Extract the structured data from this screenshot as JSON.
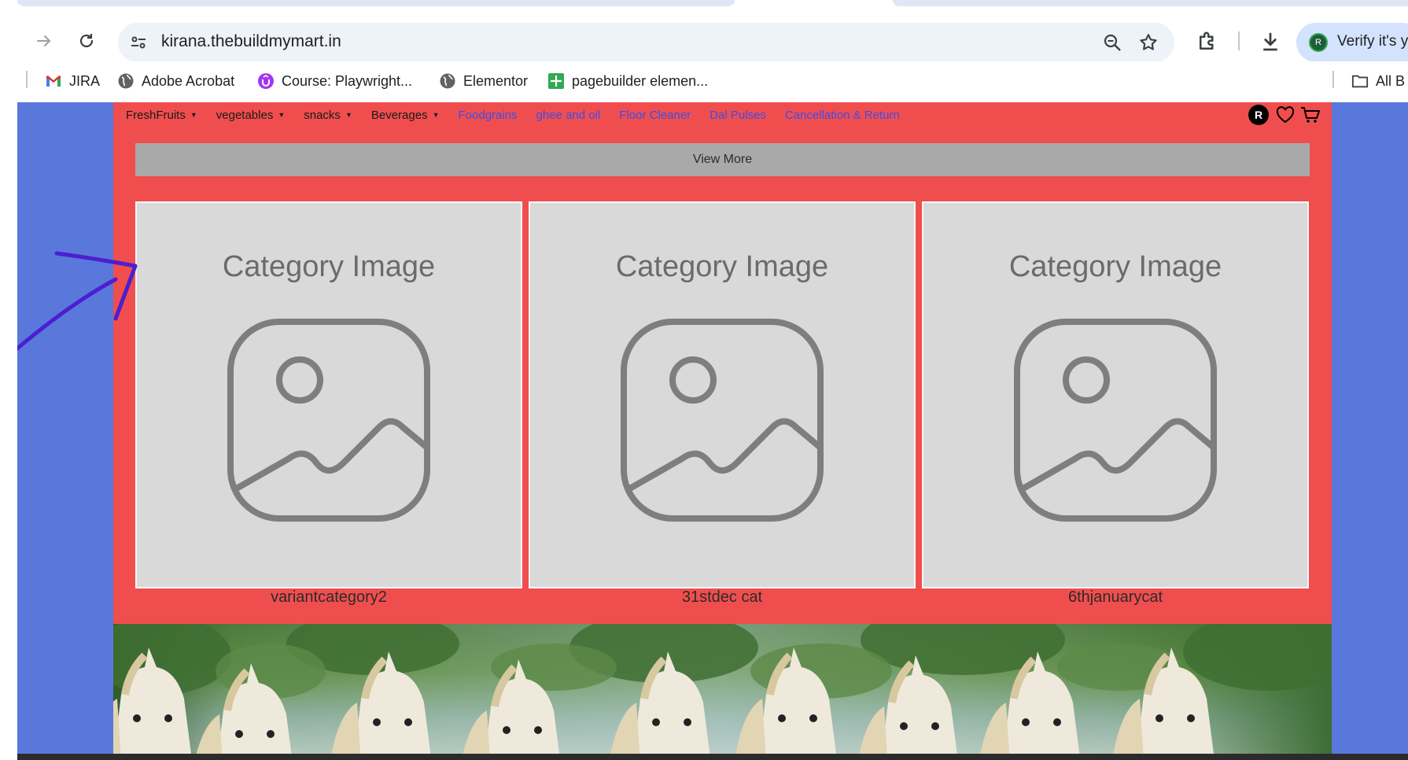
{
  "browser": {
    "url": "kirana.thebuildmymart.in",
    "profile_label": "Verify it's yo",
    "profile_initial": "R",
    "bookmarks": [
      {
        "label": "JIRA",
        "icon": "gmail-icon"
      },
      {
        "label": "Adobe Acrobat",
        "icon": "globe-icon"
      },
      {
        "label": "Course: Playwright...",
        "icon": "udemy-icon"
      },
      {
        "label": "Elementor",
        "icon": "globe-icon"
      },
      {
        "label": "pagebuilder elemen...",
        "icon": "sheets-icon"
      }
    ],
    "all_bookmarks_label": "All B"
  },
  "site": {
    "menu": [
      {
        "label": "FreshFruits",
        "dropdown": true
      },
      {
        "label": "vegetables",
        "dropdown": true
      },
      {
        "label": "snacks",
        "dropdown": true
      },
      {
        "label": "Beverages",
        "dropdown": true
      },
      {
        "label": "Foodgrains",
        "dropdown": false
      },
      {
        "label": "ghee and oil",
        "dropdown": false
      },
      {
        "label": "Floor Cleaner",
        "dropdown": false
      },
      {
        "label": "Dal Pulses",
        "dropdown": false
      },
      {
        "label": "Cancellation & Return",
        "dropdown": false
      }
    ],
    "user_initial": "R",
    "view_more_label": "View More",
    "placeholder_text": "Category Image",
    "categories": [
      {
        "name": "variantcategory2"
      },
      {
        "name": "31stdec cat"
      },
      {
        "name": "6thjanuarycat"
      }
    ],
    "colors": {
      "page_background": "#5a77dc",
      "section_background": "#f04e4e",
      "view_more_background": "#a9a9a9",
      "link_color": "#3e4de8",
      "annotation_color": "#4b1fd0"
    }
  }
}
